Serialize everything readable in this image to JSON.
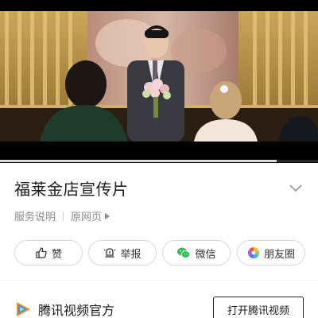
{
  "video": {
    "progress_fraction": 0.87,
    "scene_description_icon": "wedding-scene-image"
  },
  "header": {
    "title": "福莱金店宣传片"
  },
  "meta": {
    "service_label": "服务说明",
    "source_label": "原网页"
  },
  "actions": {
    "like_label": "赞",
    "report_label": "举报",
    "wechat_label": "微信",
    "moments_label": "朋友圈"
  },
  "footer": {
    "app_name": "腾讯视频官方",
    "open_label": "打开腾讯视频"
  },
  "colors": {
    "wechat_green": "#2dbd5a",
    "tencent_blue": "#1aa0ff",
    "tencent_orange": "#ff8a1a"
  }
}
